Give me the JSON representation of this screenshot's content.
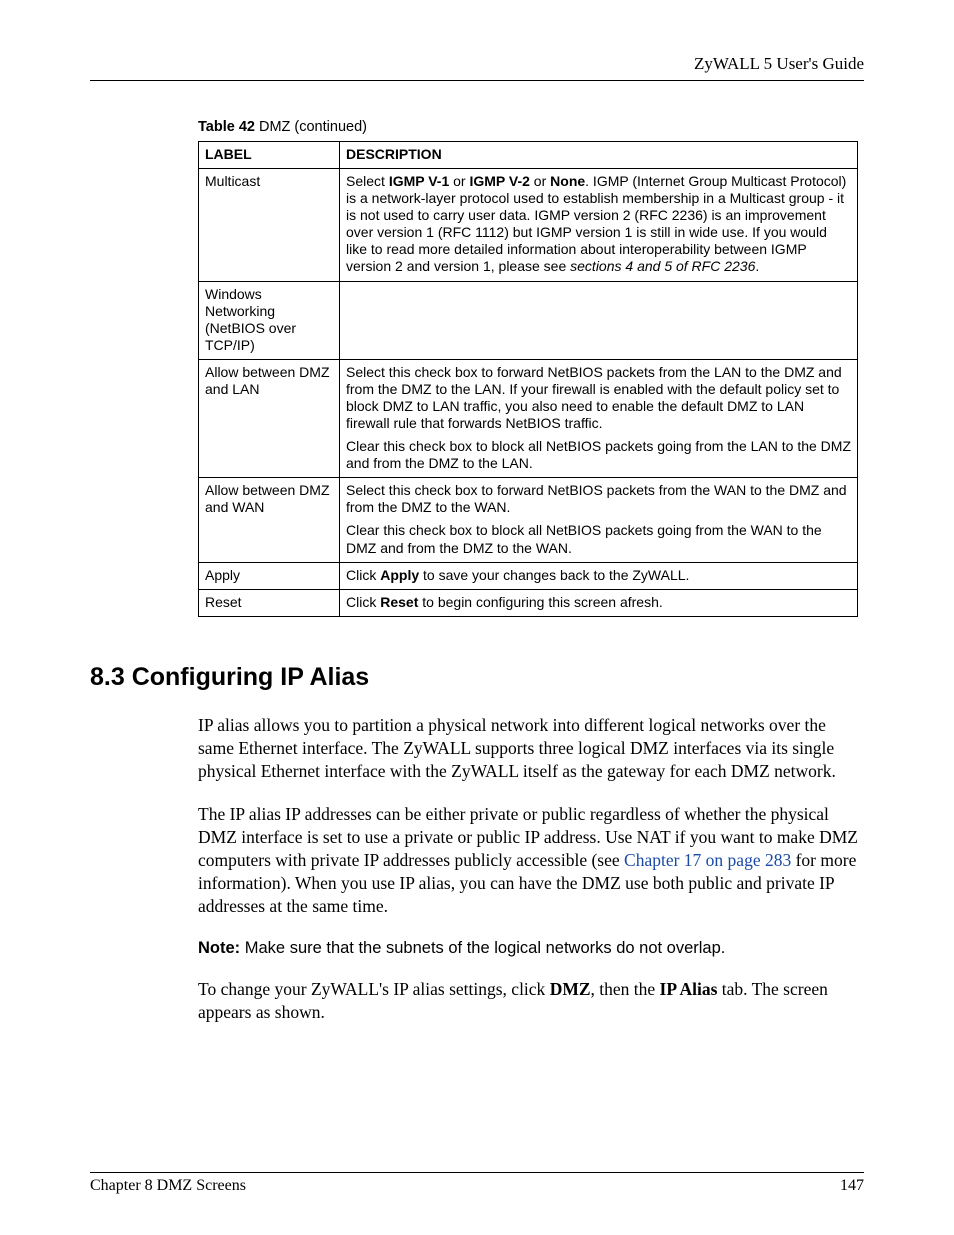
{
  "header": {
    "guide_title": "ZyWALL 5 User's Guide"
  },
  "table": {
    "caption_bold": "Table 42",
    "caption_rest": "   DMZ (continued)",
    "head_label": "LABEL",
    "head_desc": "DESCRIPTION",
    "rows": {
      "multicast": {
        "label": "Multicast",
        "desc_pre": "Select ",
        "igmp_v1": "IGMP V-1",
        "or1": " or ",
        "igmp_v2": "IGMP V-2",
        "or2": " or ",
        "none": "None",
        "desc_mid": ". IGMP (Internet Group Multicast Protocol) is a network-layer protocol used to establish membership in a Multicast group - it is not used to carry user data. IGMP version 2 (RFC 2236) is an improvement over version 1 (RFC 1112) but IGMP version 1 is still in wide use. If you would like to read more detailed information about interoperability between IGMP version 2 and version 1, please see ",
        "rfc_italic": "sections 4 and 5 of RFC 2236",
        "desc_end": "."
      },
      "winnet": {
        "label": "Windows Networking (NetBIOS over TCP/IP)"
      },
      "dmz_lan": {
        "label": "Allow between DMZ and LAN",
        "p1": "Select this check box to forward NetBIOS packets from the LAN to the DMZ and from the DMZ to the LAN. If your firewall is enabled with the default policy set to block DMZ to LAN traffic, you also need to enable the default DMZ to LAN firewall rule that forwards NetBIOS traffic.",
        "p2": "Clear this check box to block all NetBIOS packets going from the LAN to the DMZ and from the DMZ to the LAN."
      },
      "dmz_wan": {
        "label": "Allow between DMZ and WAN",
        "p1": "Select this check box to forward NetBIOS packets from the WAN to the DMZ and from the DMZ to the WAN.",
        "p2": "Clear this check box to block all NetBIOS packets going from the WAN to the DMZ and from the DMZ to the WAN."
      },
      "apply": {
        "label": "Apply",
        "pre": "Click ",
        "b": "Apply",
        "post": " to save your changes back to the ZyWALL."
      },
      "reset": {
        "label": "Reset",
        "pre": "Click ",
        "b": "Reset",
        "post": " to begin configuring this screen afresh."
      }
    }
  },
  "section": {
    "heading": "8.3  Configuring IP Alias",
    "para1": "IP alias allows you to partition a physical network into different logical networks over the same Ethernet interface. The ZyWALL supports three logical DMZ interfaces via its single physical Ethernet interface with the ZyWALL itself as the gateway for each DMZ network.",
    "para2_pre": "The IP alias IP addresses can be either private or public regardless of whether the physical DMZ interface is set to use a private or public IP address. Use NAT if you want to make DMZ computers with private IP addresses publicly accessible (see ",
    "para2_link": "Chapter 17 on page 283",
    "para2_post": " for more information). When you use IP alias, you can have the DMZ use both public and private IP addresses at the same time.",
    "note_bold": "Note:",
    "note_text": " Make sure that the subnets of the logical networks do not overlap.",
    "para3_pre": "To change your ZyWALL's IP alias settings, click ",
    "para3_b1": "DMZ",
    "para3_mid": ", then the ",
    "para3_b2": "IP Alias",
    "para3_post": " tab. The screen appears as shown."
  },
  "footer": {
    "left": "Chapter 8 DMZ Screens",
    "right": "147"
  }
}
